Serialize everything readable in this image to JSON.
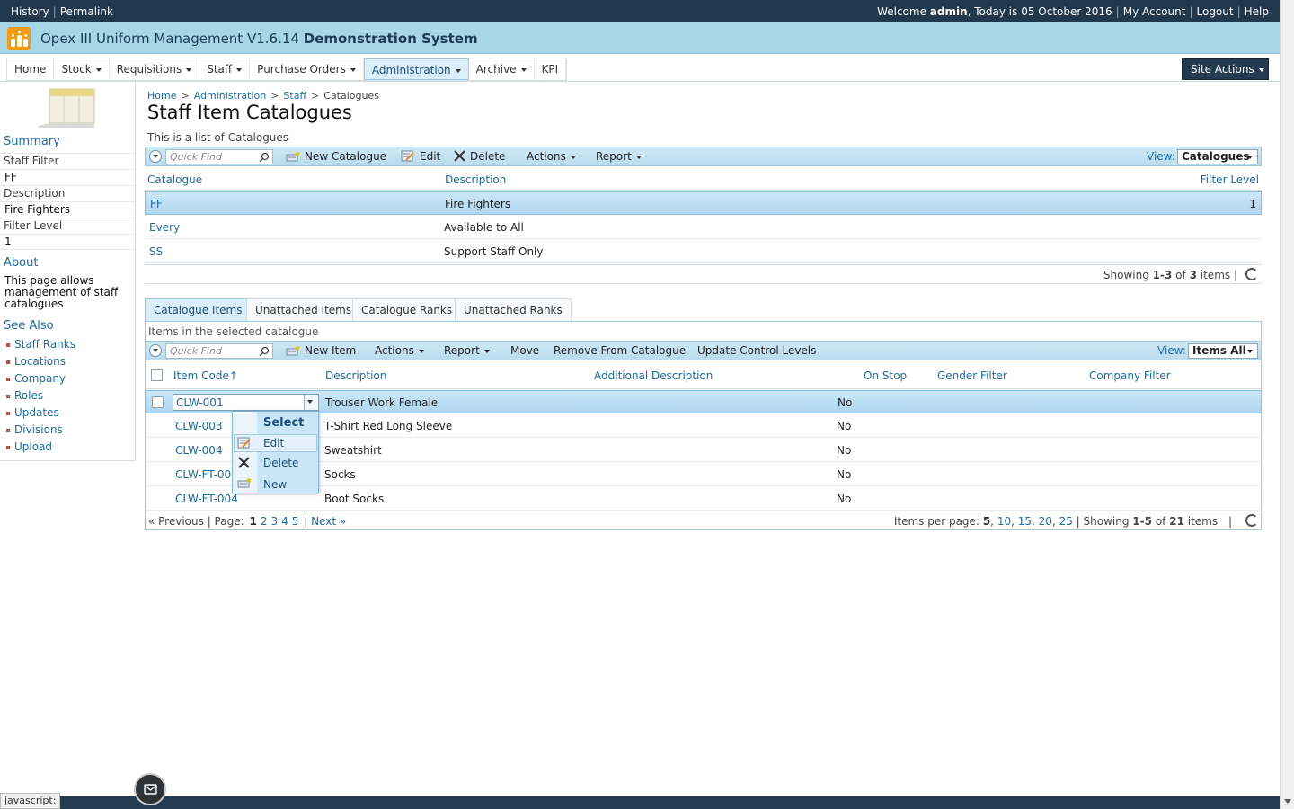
{
  "topbar": {
    "history": "History",
    "permalink": "Permalink",
    "welcome_prefix": "Welcome",
    "user": "admin",
    "today_prefix": ", Today is",
    "date": "05 October 2016",
    "my_account": "My Account",
    "logout": "Logout",
    "help": "Help"
  },
  "header": {
    "app_title": "Opex III Uniform Management V1.6.14",
    "system_name": "Demonstration System",
    "accent_color": "#a9d6e6"
  },
  "nav": {
    "items": [
      {
        "label": "Home",
        "dropdown": false
      },
      {
        "label": "Stock",
        "dropdown": true
      },
      {
        "label": "Requisitions",
        "dropdown": true
      },
      {
        "label": "Staff",
        "dropdown": true
      },
      {
        "label": "Purchase Orders",
        "dropdown": true
      },
      {
        "label": "Administration",
        "dropdown": true,
        "active": true
      },
      {
        "label": "Archive",
        "dropdown": true
      },
      {
        "label": "KPI",
        "dropdown": false
      }
    ],
    "site_actions": "Site Actions"
  },
  "sidebar": {
    "summary_heading": "Summary",
    "staff_filter_label": "Staff Filter",
    "staff_filter_value": "FF",
    "description_label": "Description",
    "description_value": "Fire Fighters",
    "filter_level_label": "Filter Level",
    "filter_level_value": "1",
    "about_heading": "About",
    "about_text": "This page allows management of staff catalogues",
    "see_also_heading": "See Also",
    "see_also": [
      "Staff Ranks",
      "Locations",
      "Company",
      "Roles",
      "Updates",
      "Divisions",
      "Upload"
    ]
  },
  "breadcrumb": {
    "items": [
      "Home",
      "Administration",
      "Staff",
      "Catalogues"
    ],
    "separator": ">"
  },
  "page": {
    "title": "Staff Item Catalogues",
    "subtitle": "This is a list of Catalogues"
  },
  "catalogues": {
    "toolbar": {
      "quick_find": "Quick Find",
      "new": "New Catalogue",
      "edit": "Edit",
      "delete": "Delete",
      "actions": "Actions",
      "report": "Report",
      "view_label": "View:",
      "view_value": "Catalogues"
    },
    "columns": [
      "Catalogue",
      "Description",
      "Filter Level"
    ],
    "rows": [
      {
        "catalogue": "FF",
        "description": "Fire Fighters",
        "filter_level": "1",
        "selected": true
      },
      {
        "catalogue": "Every",
        "description": "Available to All",
        "filter_level": ""
      },
      {
        "catalogue": "SS",
        "description": "Support Staff Only",
        "filter_level": ""
      }
    ],
    "showing_prefix": "Showing",
    "showing_range": "1-3",
    "showing_of": "of",
    "showing_total": "3",
    "showing_suffix": "items"
  },
  "tabs": [
    "Catalogue Items",
    "Unattached Items",
    "Catalogue Ranks",
    "Unattached Ranks"
  ],
  "items": {
    "description": "Items in the selected catalogue",
    "toolbar": {
      "quick_find": "Quick Find",
      "new": "New Item",
      "actions": "Actions",
      "report": "Report",
      "move": "Move",
      "remove": "Remove From Catalogue",
      "update": "Update Control Levels",
      "view_label": "View:",
      "view_value": "Items All"
    },
    "columns": [
      "Item Code",
      "Description",
      "Additional Description",
      "On Stop",
      "Gender Filter",
      "Company Filter"
    ],
    "sort_indicator": "↑",
    "rows": [
      {
        "code": "CLW-001",
        "description": "Trouser Work Female",
        "on_stop": "No",
        "selected": true
      },
      {
        "code": "CLW-003",
        "description": "T-Shirt Red Long Sleeve",
        "on_stop": "No"
      },
      {
        "code": "CLW-004",
        "description": "Sweatshirt",
        "on_stop": "No"
      },
      {
        "code": "CLW-FT-003",
        "description": "Socks",
        "on_stop": "No"
      },
      {
        "code": "CLW-FT-004",
        "description": "Boot Socks",
        "on_stop": "No"
      }
    ],
    "pager": {
      "previous": "« Previous",
      "page_label": "Page:",
      "pages": [
        "1",
        "2",
        "3",
        "4",
        "5"
      ],
      "current": "1",
      "next": "Next »",
      "per_page_label": "Items per page:",
      "per_page_options": [
        "5",
        "10",
        "15",
        "20",
        "25"
      ],
      "showing_prefix": "Showing",
      "showing_range": "1-5",
      "showing_of": "of",
      "showing_total": "21",
      "showing_suffix": "items"
    }
  },
  "context_menu": {
    "title": "Select",
    "items": [
      "Edit",
      "Delete",
      "New"
    ]
  },
  "status": {
    "text": "javascript:"
  }
}
